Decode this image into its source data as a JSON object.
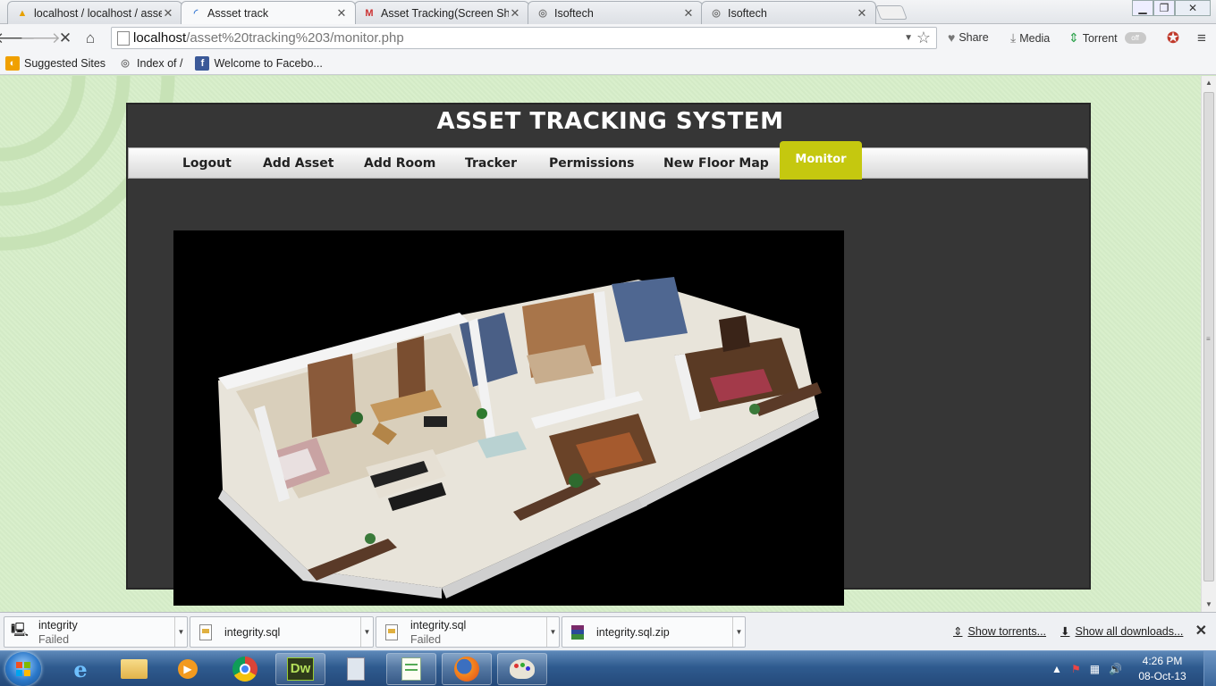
{
  "browser": {
    "tabs": [
      {
        "title": "localhost / localhost / asse",
        "icon": "phpmyadmin-icon"
      },
      {
        "title": "Assset track",
        "icon": "loading-spinner-icon",
        "active": true
      },
      {
        "title": "Asset Tracking(Screen Sho",
        "icon": "gmail-icon"
      },
      {
        "title": "Isoftech",
        "icon": "tor-onion-icon"
      },
      {
        "title": "Isoftech",
        "icon": "tor-onion-icon"
      }
    ],
    "url_host": "localhost",
    "url_path": "/asset%20tracking%203/monitor.php",
    "extensions": {
      "share": "Share",
      "media": "Media",
      "torrent": "Torrent",
      "toggle": "off"
    },
    "bookmarks": [
      {
        "label": "Suggested Sites",
        "icon": "suggested-sites-icon"
      },
      {
        "label": "Index of /",
        "icon": "tor-onion-icon"
      },
      {
        "label": "Welcome to Facebo...",
        "icon": "facebook-icon"
      }
    ]
  },
  "page": {
    "site_title": "ASSET TRACKING SYSTEM",
    "menu": [
      {
        "label": "Logout"
      },
      {
        "label": "Add Asset"
      },
      {
        "label": "Add Room"
      },
      {
        "label": "Tracker"
      },
      {
        "label": "Permissions"
      },
      {
        "label": "New Floor Map"
      },
      {
        "label": "Monitor",
        "active": true
      }
    ],
    "floor_map_image": "3d-floor-plan-apartment",
    "colors": {
      "accent": "#c5c80f",
      "panel": "#363636"
    }
  },
  "downloads": {
    "items": [
      {
        "name": "integrity",
        "status": "Failed",
        "icon": "installer-icon"
      },
      {
        "name": "integrity.sql",
        "status": "",
        "icon": "sql-file-icon"
      },
      {
        "name": "integrity.sql",
        "status": "Failed",
        "icon": "sql-file-icon"
      },
      {
        "name": "integrity.sql.zip",
        "status": "",
        "icon": "winrar-archive-icon"
      }
    ],
    "show_torrents": "Show torrents...",
    "show_all": "Show all downloads..."
  },
  "taskbar": {
    "apps": [
      "internet-explorer-icon",
      "file-explorer-icon",
      "media-player-icon",
      "chrome-icon",
      "dreamweaver-icon",
      "calculator-icon",
      "notepad-icon",
      "firefox-icon",
      "paint-icon"
    ],
    "dreamweaver_label": "Dw",
    "time": "4:26 PM",
    "date": "08-Oct-13"
  }
}
